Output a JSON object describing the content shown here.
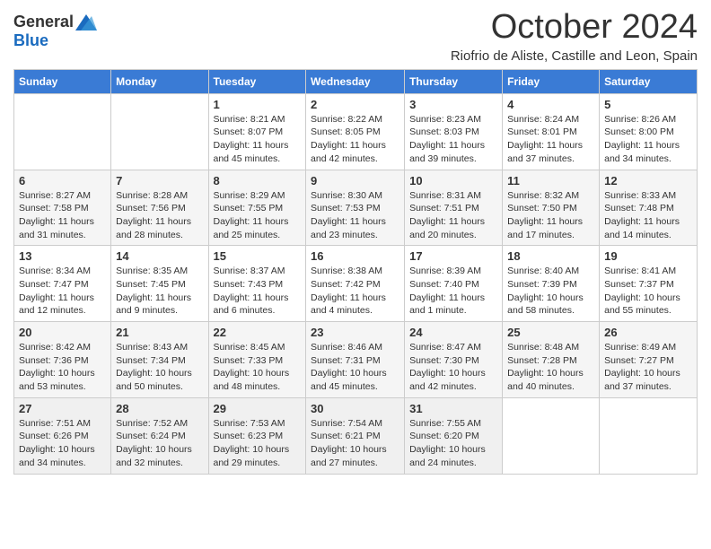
{
  "logo": {
    "general": "General",
    "blue": "Blue"
  },
  "header": {
    "title": "October 2024",
    "subtitle": "Riofrio de Aliste, Castille and Leon, Spain"
  },
  "columns": [
    "Sunday",
    "Monday",
    "Tuesday",
    "Wednesday",
    "Thursday",
    "Friday",
    "Saturday"
  ],
  "weeks": [
    [
      {
        "day": "",
        "info": ""
      },
      {
        "day": "",
        "info": ""
      },
      {
        "day": "1",
        "info": "Sunrise: 8:21 AM\nSunset: 8:07 PM\nDaylight: 11 hours and 45 minutes."
      },
      {
        "day": "2",
        "info": "Sunrise: 8:22 AM\nSunset: 8:05 PM\nDaylight: 11 hours and 42 minutes."
      },
      {
        "day": "3",
        "info": "Sunrise: 8:23 AM\nSunset: 8:03 PM\nDaylight: 11 hours and 39 minutes."
      },
      {
        "day": "4",
        "info": "Sunrise: 8:24 AM\nSunset: 8:01 PM\nDaylight: 11 hours and 37 minutes."
      },
      {
        "day": "5",
        "info": "Sunrise: 8:26 AM\nSunset: 8:00 PM\nDaylight: 11 hours and 34 minutes."
      }
    ],
    [
      {
        "day": "6",
        "info": "Sunrise: 8:27 AM\nSunset: 7:58 PM\nDaylight: 11 hours and 31 minutes."
      },
      {
        "day": "7",
        "info": "Sunrise: 8:28 AM\nSunset: 7:56 PM\nDaylight: 11 hours and 28 minutes."
      },
      {
        "day": "8",
        "info": "Sunrise: 8:29 AM\nSunset: 7:55 PM\nDaylight: 11 hours and 25 minutes."
      },
      {
        "day": "9",
        "info": "Sunrise: 8:30 AM\nSunset: 7:53 PM\nDaylight: 11 hours and 23 minutes."
      },
      {
        "day": "10",
        "info": "Sunrise: 8:31 AM\nSunset: 7:51 PM\nDaylight: 11 hours and 20 minutes."
      },
      {
        "day": "11",
        "info": "Sunrise: 8:32 AM\nSunset: 7:50 PM\nDaylight: 11 hours and 17 minutes."
      },
      {
        "day": "12",
        "info": "Sunrise: 8:33 AM\nSunset: 7:48 PM\nDaylight: 11 hours and 14 minutes."
      }
    ],
    [
      {
        "day": "13",
        "info": "Sunrise: 8:34 AM\nSunset: 7:47 PM\nDaylight: 11 hours and 12 minutes."
      },
      {
        "day": "14",
        "info": "Sunrise: 8:35 AM\nSunset: 7:45 PM\nDaylight: 11 hours and 9 minutes."
      },
      {
        "day": "15",
        "info": "Sunrise: 8:37 AM\nSunset: 7:43 PM\nDaylight: 11 hours and 6 minutes."
      },
      {
        "day": "16",
        "info": "Sunrise: 8:38 AM\nSunset: 7:42 PM\nDaylight: 11 hours and 4 minutes."
      },
      {
        "day": "17",
        "info": "Sunrise: 8:39 AM\nSunset: 7:40 PM\nDaylight: 11 hours and 1 minute."
      },
      {
        "day": "18",
        "info": "Sunrise: 8:40 AM\nSunset: 7:39 PM\nDaylight: 10 hours and 58 minutes."
      },
      {
        "day": "19",
        "info": "Sunrise: 8:41 AM\nSunset: 7:37 PM\nDaylight: 10 hours and 55 minutes."
      }
    ],
    [
      {
        "day": "20",
        "info": "Sunrise: 8:42 AM\nSunset: 7:36 PM\nDaylight: 10 hours and 53 minutes."
      },
      {
        "day": "21",
        "info": "Sunrise: 8:43 AM\nSunset: 7:34 PM\nDaylight: 10 hours and 50 minutes."
      },
      {
        "day": "22",
        "info": "Sunrise: 8:45 AM\nSunset: 7:33 PM\nDaylight: 10 hours and 48 minutes."
      },
      {
        "day": "23",
        "info": "Sunrise: 8:46 AM\nSunset: 7:31 PM\nDaylight: 10 hours and 45 minutes."
      },
      {
        "day": "24",
        "info": "Sunrise: 8:47 AM\nSunset: 7:30 PM\nDaylight: 10 hours and 42 minutes."
      },
      {
        "day": "25",
        "info": "Sunrise: 8:48 AM\nSunset: 7:28 PM\nDaylight: 10 hours and 40 minutes."
      },
      {
        "day": "26",
        "info": "Sunrise: 8:49 AM\nSunset: 7:27 PM\nDaylight: 10 hours and 37 minutes."
      }
    ],
    [
      {
        "day": "27",
        "info": "Sunrise: 7:51 AM\nSunset: 6:26 PM\nDaylight: 10 hours and 34 minutes."
      },
      {
        "day": "28",
        "info": "Sunrise: 7:52 AM\nSunset: 6:24 PM\nDaylight: 10 hours and 32 minutes."
      },
      {
        "day": "29",
        "info": "Sunrise: 7:53 AM\nSunset: 6:23 PM\nDaylight: 10 hours and 29 minutes."
      },
      {
        "day": "30",
        "info": "Sunrise: 7:54 AM\nSunset: 6:21 PM\nDaylight: 10 hours and 27 minutes."
      },
      {
        "day": "31",
        "info": "Sunrise: 7:55 AM\nSunset: 6:20 PM\nDaylight: 10 hours and 24 minutes."
      },
      {
        "day": "",
        "info": ""
      },
      {
        "day": "",
        "info": ""
      }
    ]
  ]
}
